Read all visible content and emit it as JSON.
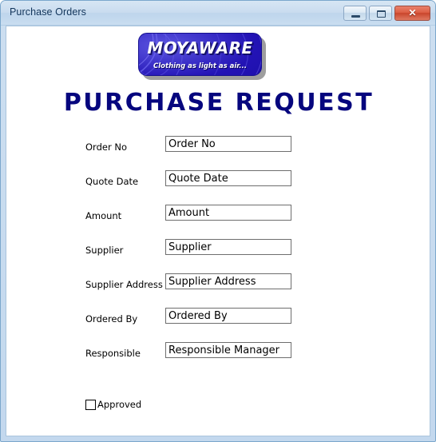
{
  "window": {
    "title": "Purchase Orders",
    "buttons": {
      "minimize_label": "–",
      "maximize_label": "□",
      "close_label": "✕"
    }
  },
  "logo": {
    "name": "MOYAWARE",
    "tagline": "Clothing as light as air...",
    "color": "#2313b5",
    "text_color": "#ffffff"
  },
  "heading": {
    "text": "PURCHASE REQUEST",
    "color": "#06067e"
  },
  "form": {
    "fields": [
      {
        "label": "Order No",
        "value": "Order No"
      },
      {
        "label": "Quote Date",
        "value": "Quote Date"
      },
      {
        "label": "Amount",
        "value": "Amount"
      },
      {
        "label": "Supplier",
        "value": "Supplier"
      },
      {
        "label": "Supplier Address",
        "value": "Supplier Address"
      },
      {
        "label": "Ordered By",
        "value": "Ordered By"
      },
      {
        "label": "Responsible",
        "value": "Responsible Manager"
      }
    ],
    "approved": {
      "label": "Approved",
      "checked": false
    }
  }
}
